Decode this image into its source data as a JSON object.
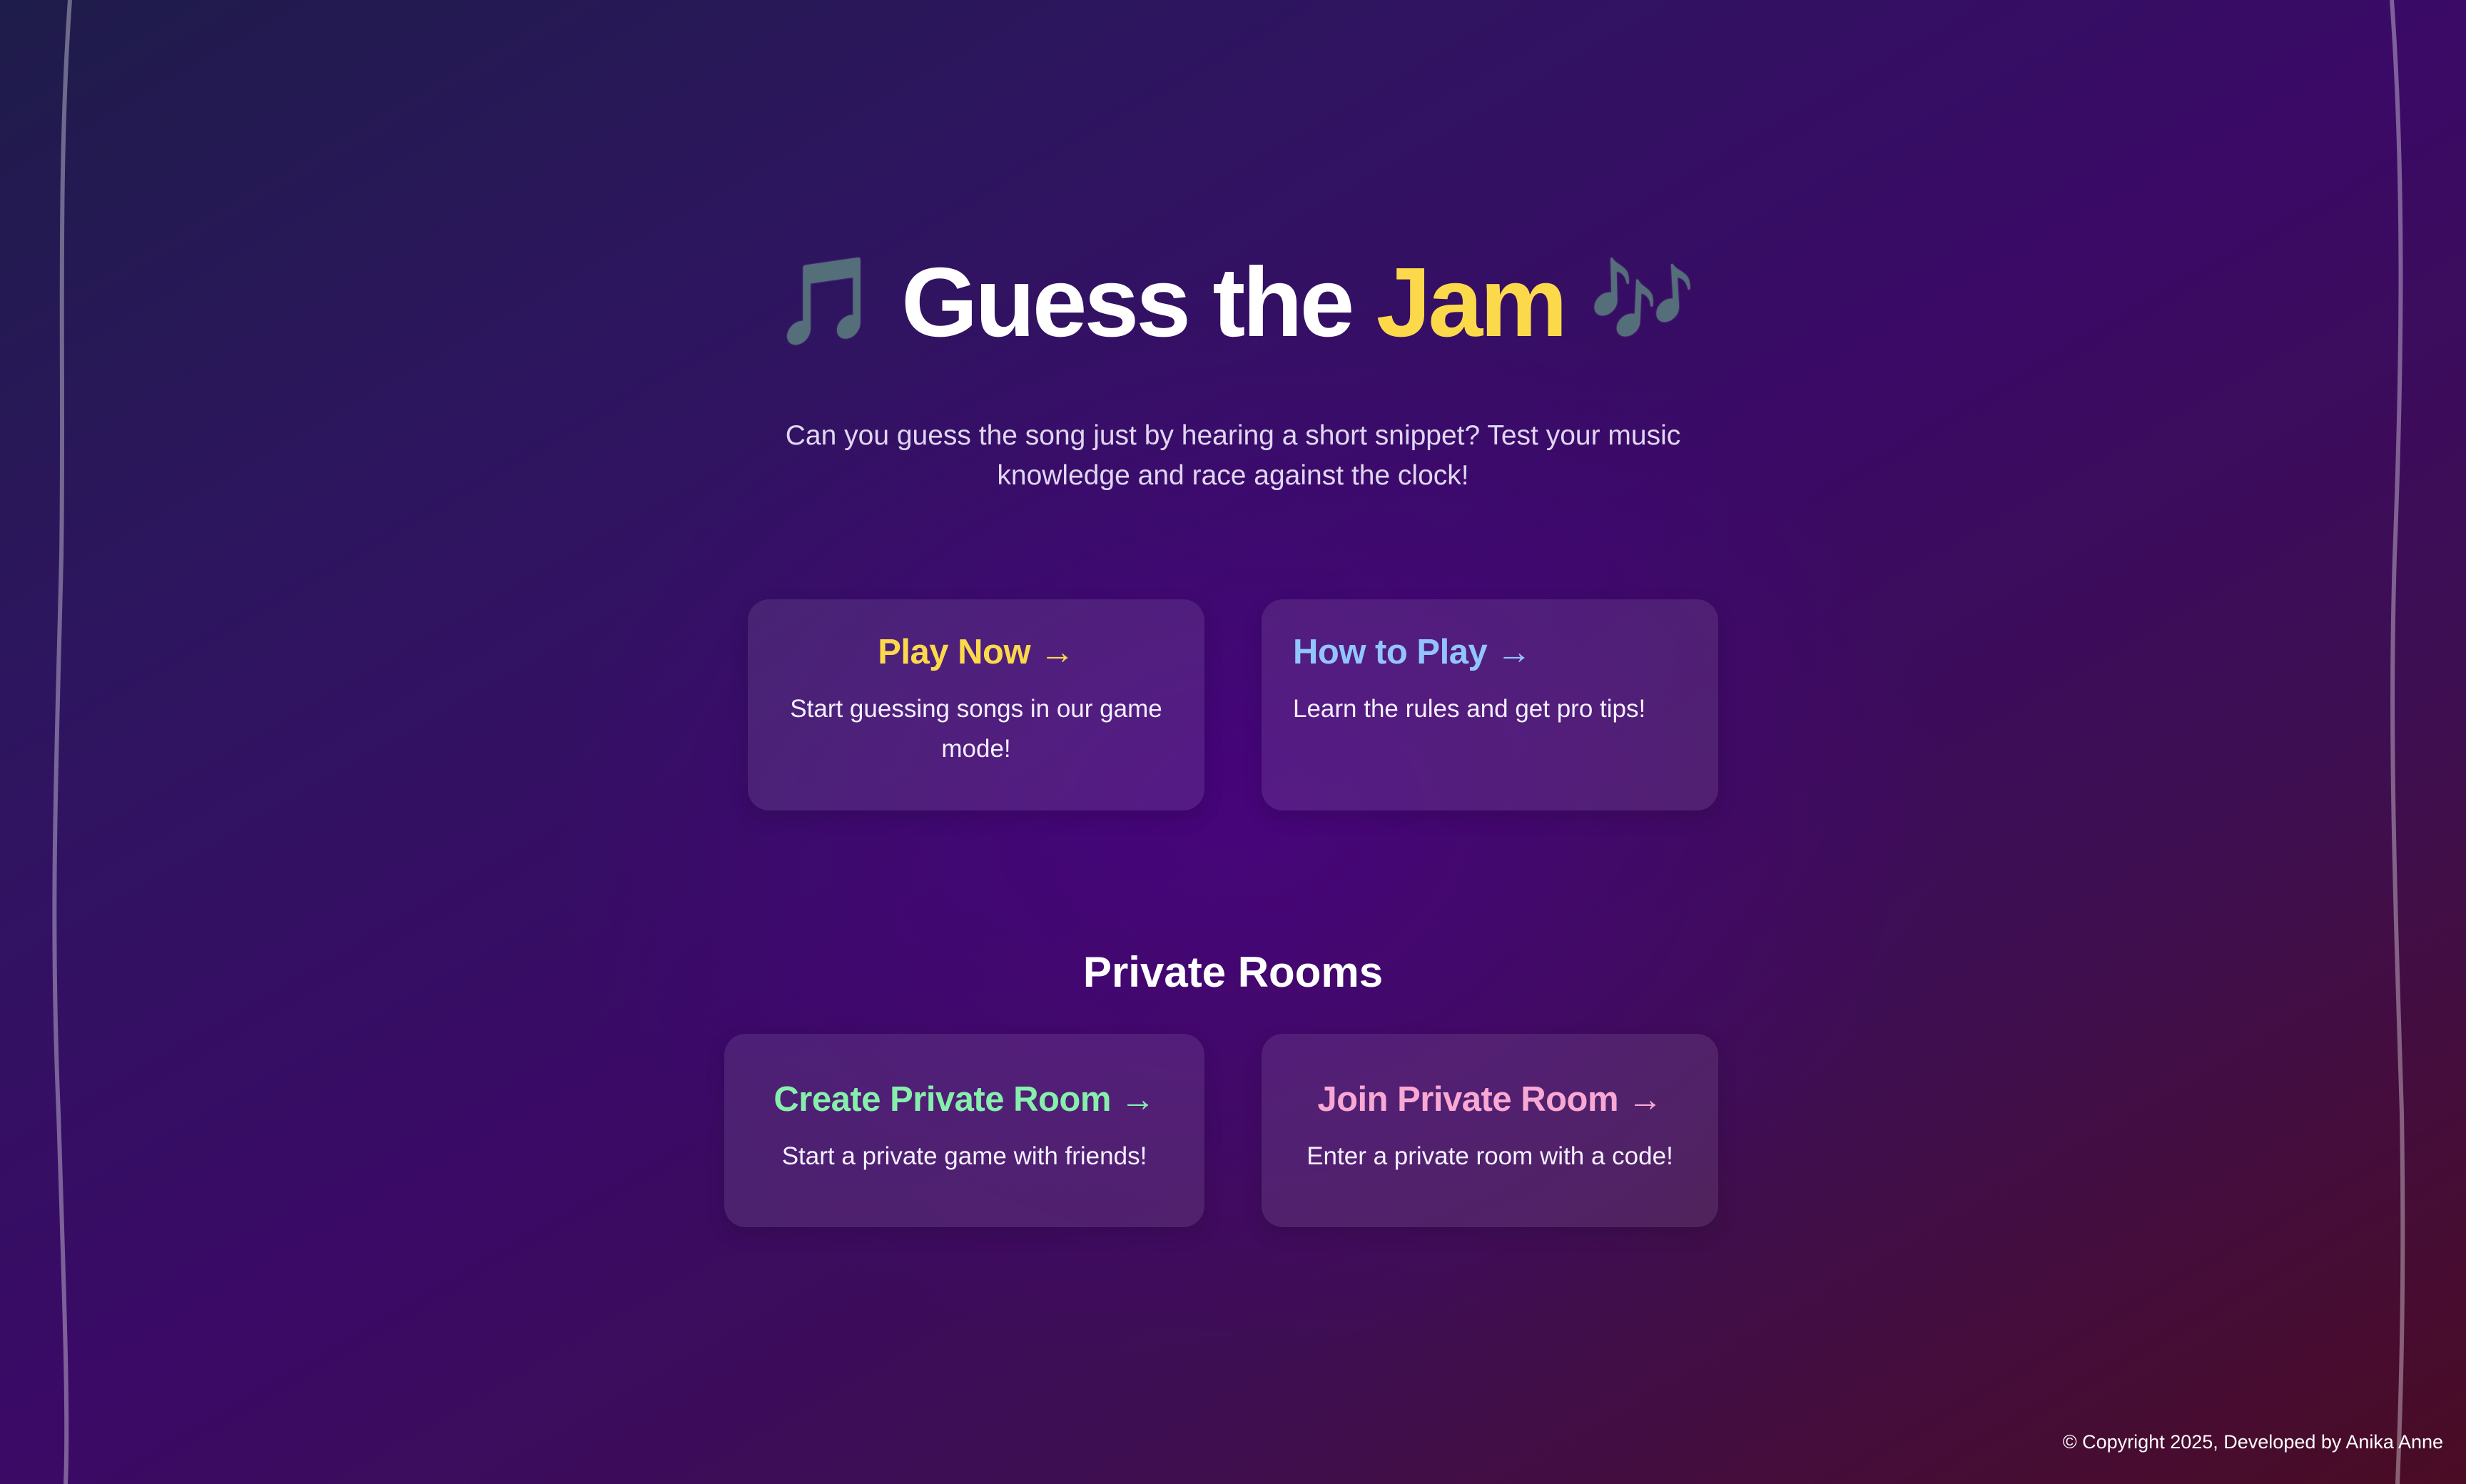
{
  "hero": {
    "note_left": "🎵",
    "title_main": "Guess the ",
    "title_accent": "Jam",
    "note_right": "🎶",
    "subtitle": "Can you guess the song just by hearing a short snippet? Test your music knowledge and race against the clock!"
  },
  "cards": {
    "play_now": {
      "title": "Play Now",
      "arrow": "→",
      "description": "Start guessing songs in our game mode!"
    },
    "how_to_play": {
      "title": "How to Play",
      "arrow": "→",
      "description": "Learn the rules and get pro tips!"
    }
  },
  "private_rooms": {
    "heading": "Private Rooms",
    "create": {
      "title": "Create Private Room",
      "arrow": "→",
      "description": "Start a private game with friends!"
    },
    "join": {
      "title": "Join Private Room",
      "arrow": "→",
      "description": "Enter a private room with a code!"
    }
  },
  "footer": {
    "copyright": "© Copyright 2025, Developed by Anika Anne"
  },
  "colors": {
    "accent_yellow": "#fcd94a",
    "accent_blue": "#93c5fd",
    "accent_green": "#86efac",
    "accent_pink": "#f9a8d4"
  },
  "icons": {
    "note_left": "musical-note-icon",
    "note_right": "musical-notes-icon",
    "arrow": "right-arrow-icon"
  }
}
